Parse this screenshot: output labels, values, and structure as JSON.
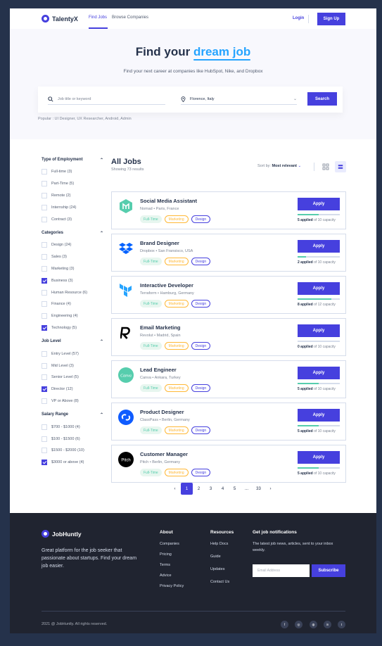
{
  "nav": {
    "brand": "TalentyX",
    "links": [
      "Find Jobs",
      "Browse Companies"
    ],
    "login": "Login",
    "signup": "Sign Up"
  },
  "hero": {
    "title_prefix": "Find your",
    "title_highlight": "dream job",
    "subtitle": "Find your next career at companies like HubSpot, Nike, and Dropbox",
    "search_placeholder": "Job title or keyword",
    "location_value": "Florence, Italy",
    "search_button": "Search",
    "popular": "Popular : UI Designer, UX Researcher, Android, Admin"
  },
  "filters": [
    {
      "title": "Type of Employment",
      "items": [
        {
          "label": "Full-time (3)",
          "checked": false
        },
        {
          "label": "Part-Time (5)",
          "checked": false
        },
        {
          "label": "Remote (2)",
          "checked": false
        },
        {
          "label": "Internship (24)",
          "checked": false
        },
        {
          "label": "Contract (3)",
          "checked": false
        }
      ]
    },
    {
      "title": "Categories",
      "items": [
        {
          "label": "Design (24)",
          "checked": false
        },
        {
          "label": "Sales (3)",
          "checked": false
        },
        {
          "label": "Marketing (3)",
          "checked": false
        },
        {
          "label": "Business (3)",
          "checked": true
        },
        {
          "label": "Human Resource (6)",
          "checked": false
        },
        {
          "label": "Finance (4)",
          "checked": false
        },
        {
          "label": "Engineering (4)",
          "checked": false
        },
        {
          "label": "Technology (5)",
          "checked": true
        }
      ]
    },
    {
      "title": "Job Level",
      "items": [
        {
          "label": "Entry Level (57)",
          "checked": false
        },
        {
          "label": "Mid Level (3)",
          "checked": false
        },
        {
          "label": "Senior Level (5)",
          "checked": false
        },
        {
          "label": "Director (12)",
          "checked": true
        },
        {
          "label": "VP or Above (8)",
          "checked": false
        }
      ]
    },
    {
      "title": "Salary Range",
      "items": [
        {
          "label": "$700 - $1000 (4)",
          "checked": false
        },
        {
          "label": "$100 - $1500 (6)",
          "checked": false
        },
        {
          "label": "$1500 - $2000 (10)",
          "checked": false
        },
        {
          "label": "$3000 or above (4)",
          "checked": true
        }
      ]
    }
  ],
  "jobs": {
    "title": "All Jobs",
    "count": "Showing 73 results",
    "sort_label": "Sort by:",
    "sort_value": "Most relevant",
    "apply_label": "Apply",
    "tags": [
      "Full-Time",
      "Marketing",
      "Design"
    ],
    "list": [
      {
        "title": "Social Media Assistant",
        "company": "Nomad",
        "location": "Paris, France",
        "applied": "5 applied",
        "capacity": "of 10 capacity",
        "progress": 0.5,
        "logo": "nomad-logo",
        "color": "#56cdad"
      },
      {
        "title": "Brand Designer",
        "company": "Dropbox",
        "location": "San Fransisco, USA",
        "applied": "2 applied",
        "capacity": "of 10 capacity",
        "progress": 0.2,
        "logo": "dropbox-logo",
        "color": "#0061ff"
      },
      {
        "title": "Interactive Developer",
        "company": "Terraform",
        "location": "Hamburg, Germany",
        "applied": "8 applied",
        "capacity": "of 12 capacity",
        "progress": 0.8,
        "logo": "terraform-logo",
        "color": "#26a4ff"
      },
      {
        "title": "Email Marketing",
        "company": "Revolut",
        "location": "Madrid, Spain",
        "applied": "0 applied",
        "capacity": "of 10 capacity",
        "progress": 0.0,
        "logo": "revolut-logo",
        "color": "#000000"
      },
      {
        "title": "Lead Engineer",
        "company": "Canva",
        "location": "Ankara, Turkey",
        "applied": "5 applied",
        "capacity": "of 10 capacity",
        "progress": 0.5,
        "logo": "canva-logo",
        "color": "#56cdad"
      },
      {
        "title": "Product Designer",
        "company": "ClassPass",
        "location": "Berlin, Germany",
        "applied": "5 applied",
        "capacity": "of 10 capacity",
        "progress": 0.5,
        "logo": "classpass-logo",
        "color": "#0f5cff"
      },
      {
        "title": "Customer Manager",
        "company": "Pitch",
        "location": "Berlin, Germany",
        "applied": "5 applied",
        "capacity": "of 10 capacity",
        "progress": 0.5,
        "logo": "pitch-logo",
        "color": "#000000"
      }
    ],
    "pagination": [
      "1",
      "2",
      "3",
      "4",
      "5",
      "...",
      "33"
    ],
    "current_page": "1"
  },
  "footer": {
    "brand": "JobHuntly",
    "description": "Great platform for the job seeker that passionate about startups. Find your dream job easier.",
    "about_title": "About",
    "about_links": [
      "Companies",
      "Pricing",
      "Terms",
      "Advice",
      "Privacy Policy"
    ],
    "resources_title": "Resources",
    "resources_links": [
      "Help Docs",
      "Guide",
      "Updates",
      "Contact Us"
    ],
    "notif_title": "Get job notifications",
    "notif_text": "The latest job news, articles, sent to your inbox weekly.",
    "email_placeholder": "Email Address",
    "subscribe": "Subscribe",
    "copyright": "2021 @ JobHuntly. All rights reserved.",
    "social_icons": [
      "f",
      "◎",
      "◍",
      "in",
      "t"
    ]
  },
  "colors": {
    "primary": "#4640de",
    "accent": "#26a4ff",
    "green": "#56cdad",
    "orange": "#ffb836",
    "dark": "#202430"
  }
}
